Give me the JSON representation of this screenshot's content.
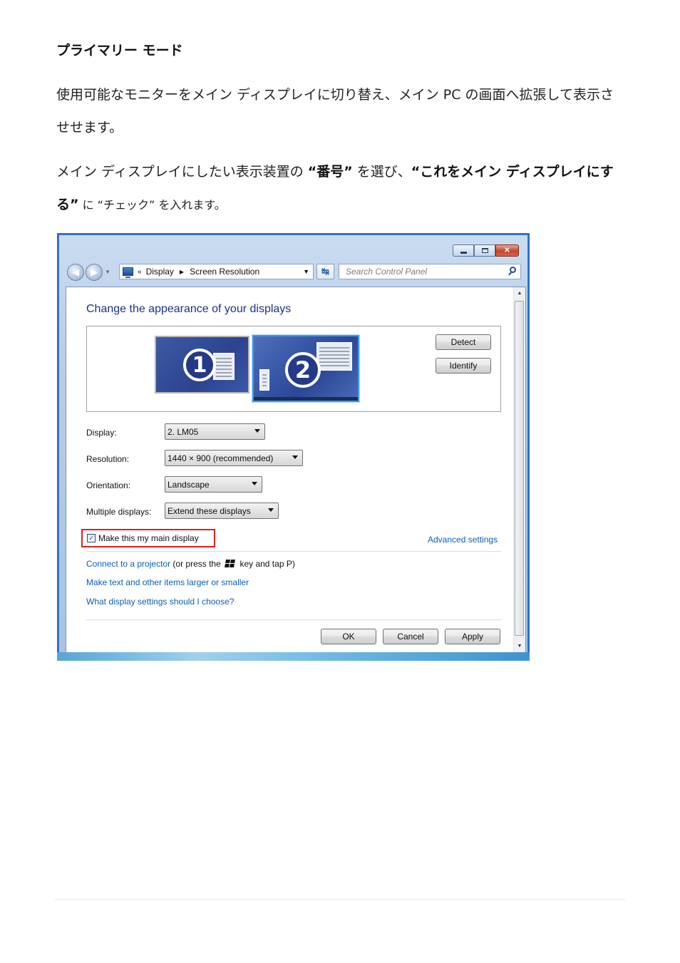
{
  "doc": {
    "title": "プライマリー モード",
    "para1": "使用可能なモニターをメイン ディスプレイに切り替え、メイン PC の画面へ拡張して表示させせます。",
    "para2_a": "メイン ディスプレイにしたい表示装置の ",
    "para2_b": "“番号”",
    "para2_c": " を選び、",
    "para2_d": "“これをメイン ディスプレイにする”",
    "para2_e": " に “チェック” を入れます。"
  },
  "window": {
    "breadcrumb_prefix": "«",
    "breadcrumb": [
      "Display",
      "Screen Resolution"
    ],
    "search_placeholder": "Search Control Panel",
    "heading": "Change the appearance of your displays",
    "monitors": [
      "1",
      "2"
    ],
    "selected_monitor": "2",
    "detect_label": "Detect",
    "identify_label": "Identify",
    "display_label": "Display:",
    "display_value": "2. LM05",
    "resolution_label": "Resolution:",
    "resolution_value": "1440 × 900 (recommended)",
    "orientation_label": "Orientation:",
    "orientation_value": "Landscape",
    "multiple_label": "Multiple displays:",
    "multiple_value": "Extend these displays",
    "main_display_label": "Make this my main display",
    "main_display_checked": true,
    "advanced_link": "Advanced settings",
    "projector_link": "Connect to a projector",
    "projector_hint_a": " (or press the ",
    "projector_hint_b": " key and tap P)",
    "text_size_link": "Make text and other items larger or smaller",
    "help_link": "What display settings should I choose?",
    "ok_label": "OK",
    "cancel_label": "Cancel",
    "apply_label": "Apply"
  },
  "colors": {
    "link": "#0b5fb3",
    "heading": "#1e3287",
    "highlight_box": "#e02020",
    "selected_monitor_border": "#3a9be4"
  }
}
